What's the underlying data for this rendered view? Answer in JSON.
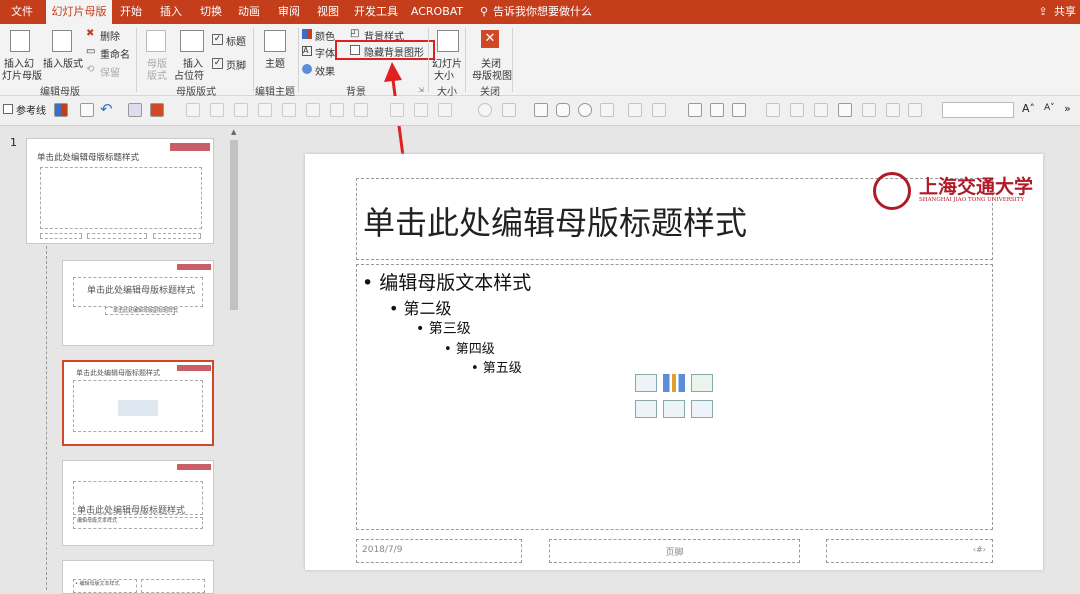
{
  "tabs": {
    "file": "文件",
    "slide_master": "幻灯片母版",
    "home": "开始",
    "insert": "插入",
    "transitions": "切换",
    "animations": "动画",
    "review": "审阅",
    "view": "视图",
    "developer": "开发工具",
    "acrobat": "ACROBAT",
    "tell_me": "告诉我你想要做什么",
    "share": "共享"
  },
  "ribbon": {
    "insert_master": "插入幻\n灯片母版",
    "insert_master_l1": "插入幻",
    "insert_master_l2": "灯片母版",
    "insert_layout": "插入版式",
    "delete": "删除",
    "rename": "重命名",
    "preserve": "保留",
    "group_edit_master": "编辑母版",
    "master_layout_l1": "母版",
    "master_layout_l2": "版式",
    "insert_placeholder_l1": "插入",
    "insert_placeholder_l2": "占位符",
    "title_check": "标题",
    "footer_check": "页脚",
    "group_master_layout": "母版版式",
    "themes": "主题",
    "group_edit_theme": "编辑主题",
    "colors": "颜色",
    "fonts": "字体",
    "effects": "效果",
    "bg_styles": "背景样式",
    "hide_bg": "隐藏背景图形",
    "group_background": "背景",
    "slide_size_l1": "幻灯片",
    "slide_size_l2": "大小",
    "group_size": "大小",
    "close_l1": "关闭",
    "close_l2": "母版视图",
    "group_close": "关闭"
  },
  "qbar": {
    "guides": "参考线"
  },
  "thumbnails": {
    "slide_number": "1",
    "master_title": "单击此处编辑母版标题样式",
    "layout2_title": "单击此处编辑母版标题样式",
    "layout2_sub": "单击此处编辑母版副标题样式",
    "layout3_title": "单击此处编辑母版标题样式",
    "layout4_title": "单击此处编辑母版标题样式",
    "layout4_sub": "编辑母版文本样式",
    "layout5_text": "• 编辑母版文本样式"
  },
  "slide": {
    "title": "单击此处编辑母版标题样式",
    "levels": [
      "• 编辑母版文本样式",
      "• 第二级",
      "• 第三级",
      "• 第四级",
      "• 第五级"
    ],
    "logo_cn": "上海交通大学",
    "logo_en": "SHANGHAI JIAO TONG UNIVERSITY",
    "date": "2018/7/9",
    "footer": "页脚",
    "page_no": "‹#›"
  },
  "colors": {
    "accent": "#c43e1c",
    "highlight_box": "#e02020",
    "selection": "#d24726",
    "logo_red": "#b01a26"
  }
}
